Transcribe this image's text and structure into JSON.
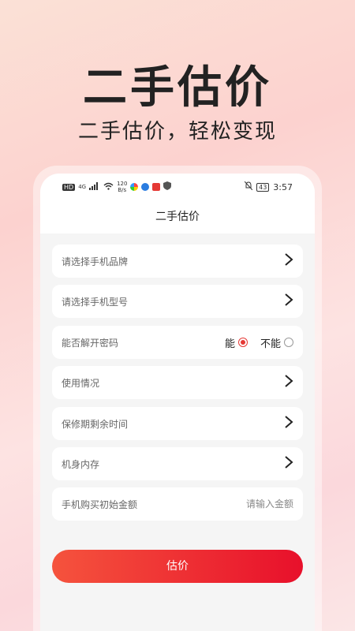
{
  "hero": {
    "title": "二手估价",
    "subtitle": "二手估价，轻松变现"
  },
  "status_bar": {
    "left_chip": "HD",
    "network": "4G",
    "speed_value": "120",
    "speed_unit": "B/s",
    "battery": "43",
    "time": "3:57"
  },
  "nav": {
    "title": "二手估价"
  },
  "form": {
    "brand": {
      "placeholder": "请选择手机品牌"
    },
    "model": {
      "placeholder": "请选择手机型号"
    },
    "unlock": {
      "label": "能否解开密码",
      "options": [
        "能",
        "不能"
      ],
      "selected": "能"
    },
    "condition": {
      "placeholder": "使用情况"
    },
    "warranty": {
      "placeholder": "保修期剩余时间"
    },
    "storage": {
      "placeholder": "机身内存"
    },
    "price": {
      "label": "手机购买初始金额",
      "input_placeholder": "请输入金额"
    },
    "submit_label": "估价"
  },
  "colors": {
    "accent": "#e8102b",
    "accent_start": "#f5533d"
  }
}
